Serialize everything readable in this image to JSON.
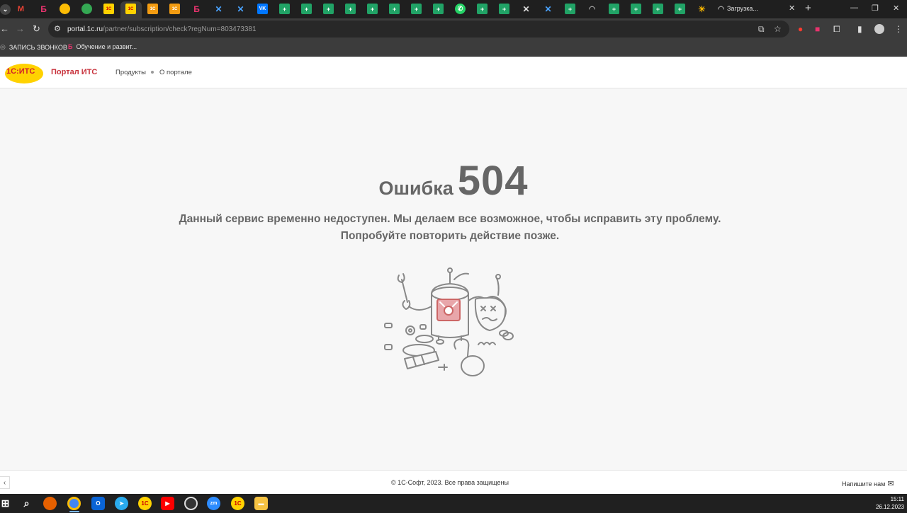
{
  "browser": {
    "loading_tab_title": "Загрузка...",
    "url_host": "portal.1c.ru",
    "url_path": "/partner/subscription/check?regNum=803473381",
    "bookmarks": [
      "ЗАПИСЬ ЗВОНКОВ",
      "Обучение и развит..."
    ]
  },
  "header": {
    "logo_text": "1С:ИТС",
    "portal_title": "Портал ИТС",
    "nav": [
      "Продукты",
      "О портале"
    ]
  },
  "error": {
    "word": "Ошибка",
    "code": "504",
    "message": "Данный сервис временно недоступен. Мы делаем все возможное, чтобы исправить эту проблему. Попробуйте повторить действие позже."
  },
  "footer": {
    "copyright": "© 1С-Софт, 2023. Все права защищены",
    "write_us": "Напишите нам"
  },
  "taskbar": {
    "time": "15:11",
    "date": "26.12.2023"
  },
  "colors": {
    "brand_red": "#c8323c",
    "logo_yellow": "#ffd200",
    "text_gray": "#666666"
  }
}
